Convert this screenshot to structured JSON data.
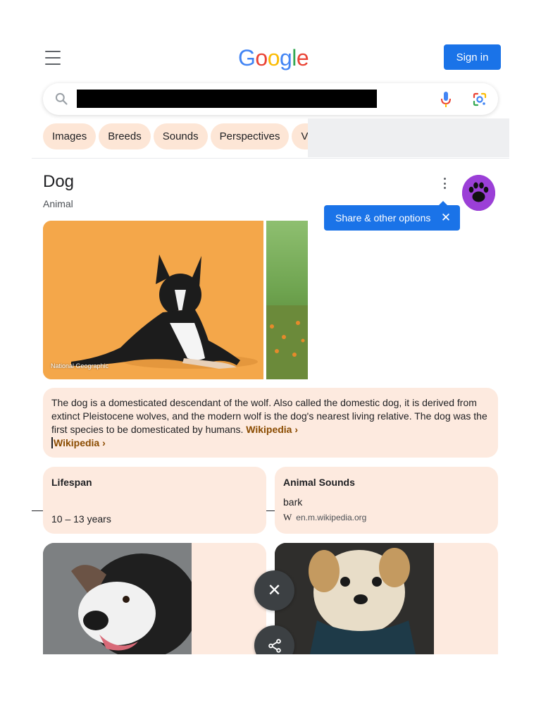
{
  "header": {
    "logo_letters": [
      "G",
      "o",
      "o",
      "g",
      "l",
      "e"
    ],
    "signin_label": "Sign in"
  },
  "search": {
    "query": ""
  },
  "chips": [
    "Images",
    "Breeds",
    "Sounds",
    "Perspectives",
    "Vic"
  ],
  "entity": {
    "title": "Dog",
    "subtitle": "Animal"
  },
  "tooltip": {
    "label": "Share & other options",
    "close_glyph": "✕"
  },
  "image": {
    "caption": "National Geographic"
  },
  "description": {
    "text": "The dog is a domesticated descendant of the wolf. Also called the domestic dog, it is derived from extinct Pleistocene wolves, and the modern wolf is the dog's nearest living relative. The dog was the first species to be domesticated by humans.",
    "inline_link": "Wikipedia ›",
    "source_link": "Wikipedia ›"
  },
  "cards": {
    "lifespan": {
      "title": "Lifespan",
      "value": "10 – 13 years"
    },
    "sounds": {
      "title": "Animal Sounds",
      "value": "bark",
      "source_glyph": "W",
      "source": "en.m.wikipedia.org"
    }
  },
  "fabs": {
    "close_glyph": "✕"
  },
  "colors": {
    "brand_blue": "#1a73e8",
    "card_bg": "#fdeadf",
    "link_brown": "#8a4b00",
    "avatar_purple": "#9b3fd7"
  }
}
